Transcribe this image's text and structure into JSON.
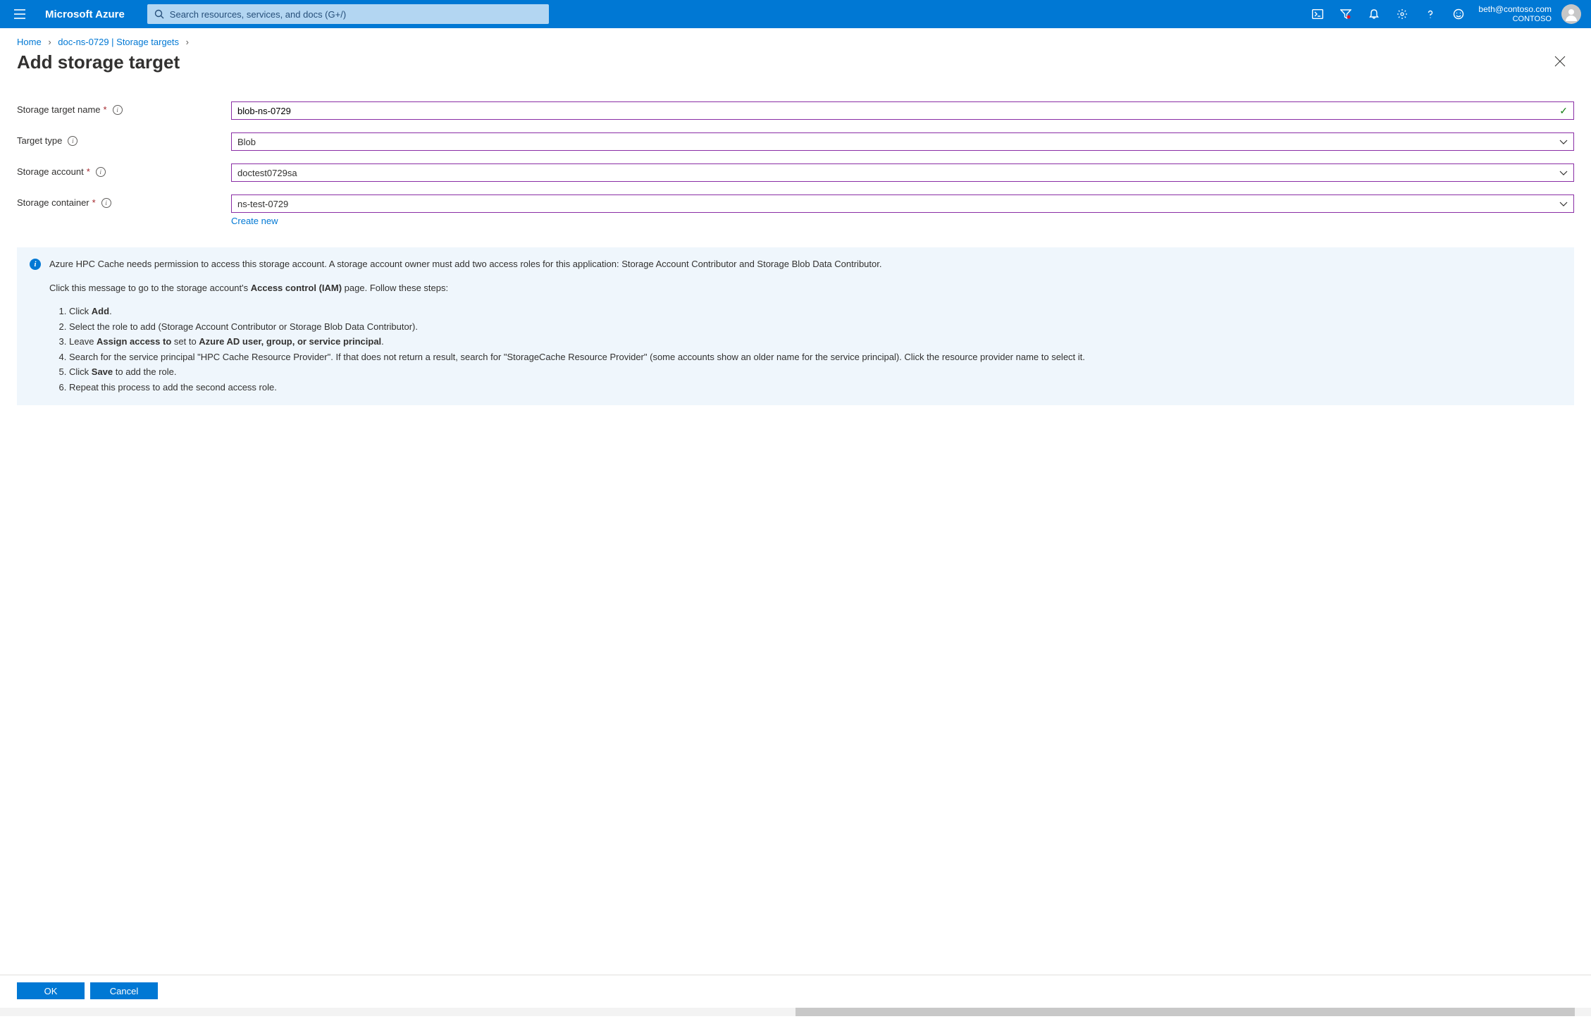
{
  "header": {
    "brand": "Microsoft Azure",
    "search_placeholder": "Search resources, services, and docs (G+/)",
    "user_email": "beth@contoso.com",
    "directory": "CONTOSO"
  },
  "breadcrumb": {
    "home": "Home",
    "current": "doc-ns-0729 | Storage targets"
  },
  "page": {
    "title": "Add storage target"
  },
  "form": {
    "name_label": "Storage target name",
    "name_value": "blob-ns-0729",
    "type_label": "Target type",
    "type_value": "Blob",
    "account_label": "Storage account",
    "account_value": "doctest0729sa",
    "container_label": "Storage container",
    "container_value": "ns-test-0729",
    "create_new": "Create new"
  },
  "info": {
    "intro": "Azure HPC Cache needs permission to access this storage account. A storage account owner must add two access roles for this application: Storage Account Contributor and Storage Blob Data Contributor.",
    "lead_pre": "Click this message to go to the storage account's ",
    "lead_bold": "Access control (IAM)",
    "lead_post": " page. Follow these steps:",
    "step1_pre": "Click ",
    "step1_bold": "Add",
    "step1_post": ".",
    "step2": "Select the role to add (Storage Account Contributor or Storage Blob Data Contributor).",
    "step3_pre": "Leave ",
    "step3_b1": "Assign access to",
    "step3_mid": " set to ",
    "step3_b2": "Azure AD user, group, or service principal",
    "step3_post": ".",
    "step4": "Search for the service principal \"HPC Cache Resource Provider\". If that does not return a result, search for \"StorageCache Resource Provider\" (some accounts show an older name for the service principal). Click the resource provider name to select it.",
    "step5_pre": "Click ",
    "step5_bold": "Save",
    "step5_post": " to add the role.",
    "step6": "Repeat this process to add the second access role."
  },
  "footer": {
    "ok": "OK",
    "cancel": "Cancel"
  }
}
